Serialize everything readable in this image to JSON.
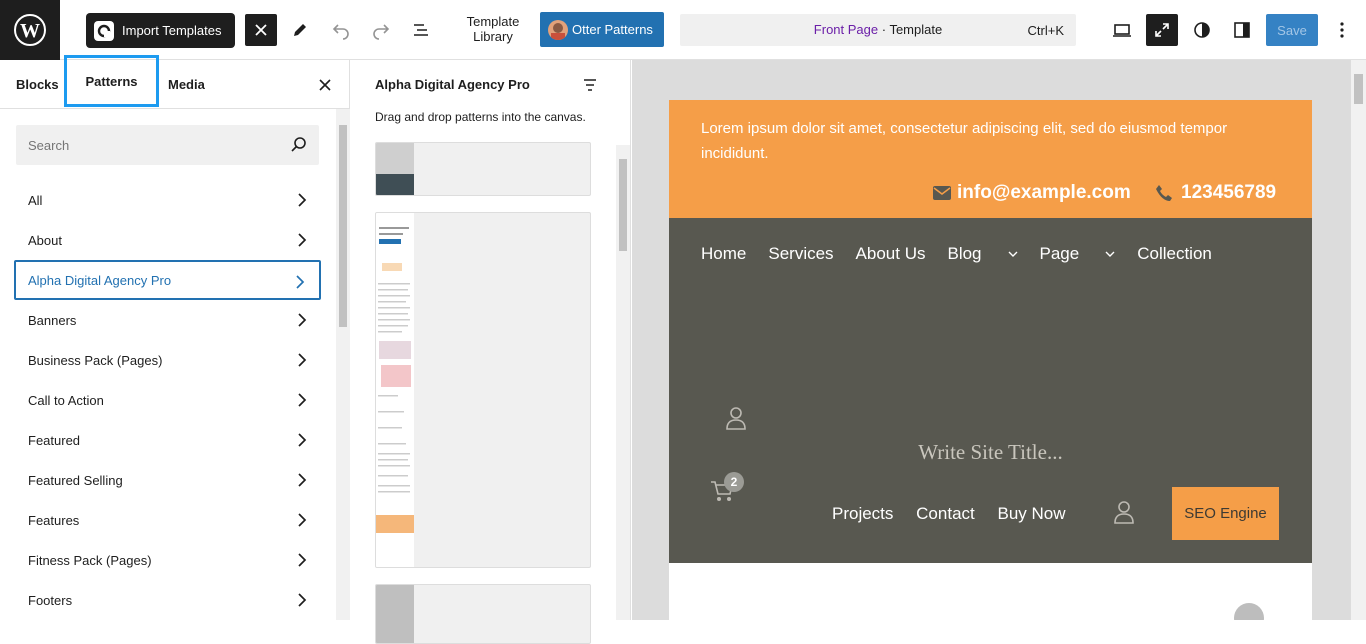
{
  "topbar": {
    "import_label": "Import Templates",
    "template_library": [
      "Template",
      "Library"
    ],
    "otter_label": "Otter Patterns",
    "command": {
      "page": "Front Page",
      "separator": " · ",
      "type": "Template",
      "shortcut": "Ctrl+K"
    },
    "save_label": "Save"
  },
  "sidebar": {
    "tabs": [
      "Blocks",
      "Patterns",
      "Media"
    ],
    "active_tab": "Patterns",
    "search_placeholder": "Search",
    "categories": [
      "All",
      "About",
      "Alpha Digital Agency Pro",
      "Banners",
      "Business Pack (Pages)",
      "Call to Action",
      "Featured",
      "Featured Selling",
      "Features",
      "Fitness Pack (Pages)",
      "Footers"
    ],
    "selected_category": "Alpha Digital Agency Pro"
  },
  "pattern_panel": {
    "title": "Alpha Digital Agency Pro",
    "description": "Drag and drop patterns into the canvas."
  },
  "canvas": {
    "lorem": "Lorem ipsum dolor sit amet, consectetur adipiscing elit, sed do eiusmod tempor incididunt.",
    "email": "info@example.com",
    "phone": "123456789",
    "nav_primary": [
      "Home",
      "Services",
      "About Us",
      "Blog",
      "Page",
      "Collection"
    ],
    "cart_count": "2",
    "site_title": "Write Site Title...",
    "nav_secondary": [
      "Projects",
      "Contact",
      "Buy Now"
    ],
    "cta_label": "SEO Engine"
  },
  "colors": {
    "accent": "#2271b1",
    "orange": "#f59e48",
    "nav_bg": "#585850",
    "highlight": "#1d9bf0"
  }
}
